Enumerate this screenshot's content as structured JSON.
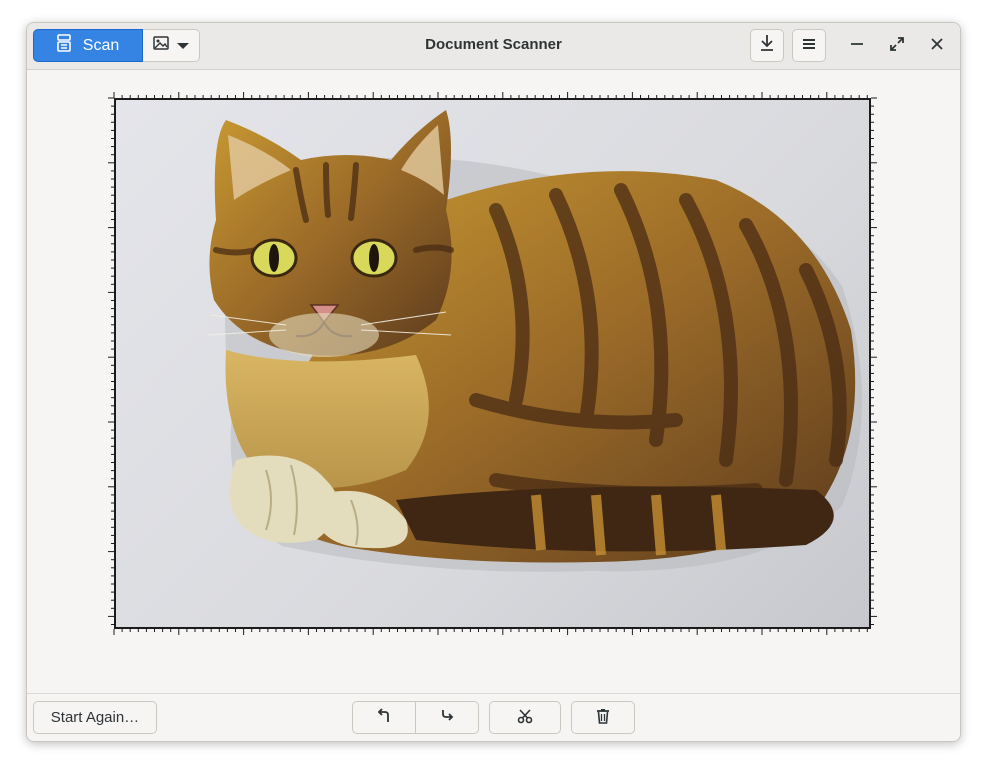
{
  "header": {
    "scan_label": "Scan",
    "title": "Document Scanner",
    "icons": {
      "scan": "scanner-icon",
      "type": "image-icon",
      "dropdown": "chevron-down-icon",
      "save": "download-icon",
      "menu": "hamburger-menu-icon",
      "minimize": "minimize-icon",
      "maximize": "maximize-icon",
      "close": "close-icon"
    }
  },
  "page": {
    "content": "scanned-cat-painting"
  },
  "footer": {
    "start_again_label": "Start Again…",
    "icons": {
      "rotate_left": "rotate-left-icon",
      "rotate_right": "rotate-right-icon",
      "crop": "scissors-icon",
      "delete": "trash-icon"
    }
  },
  "colors": {
    "accent": "#3584e4",
    "window_bg": "#f6f5f4",
    "headerbar_bg": "#ebe9e7"
  }
}
